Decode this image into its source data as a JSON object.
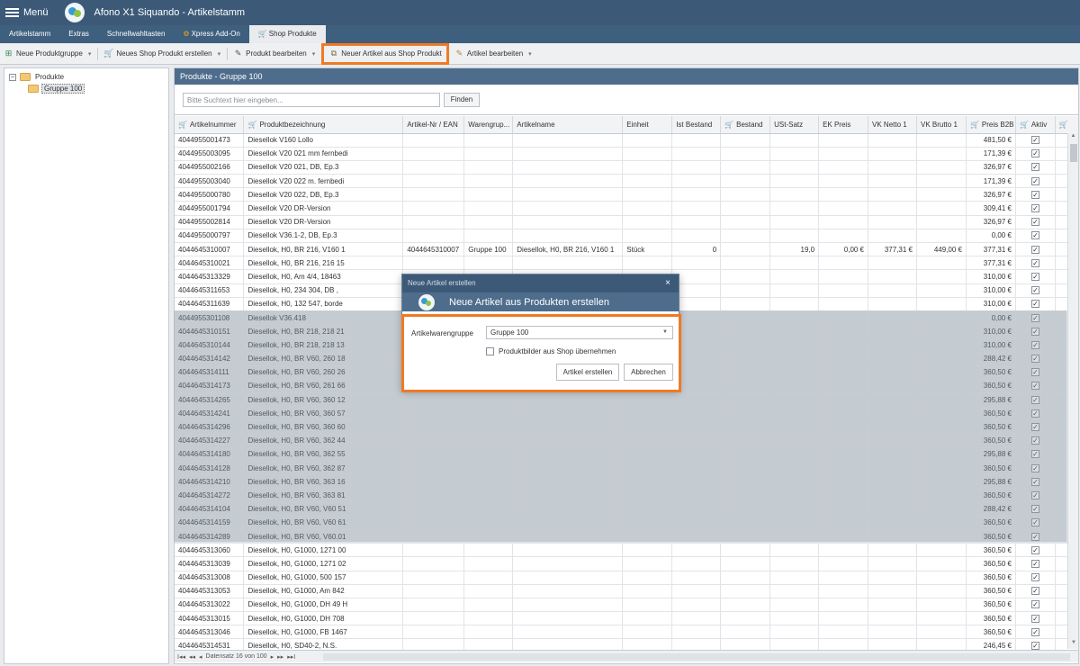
{
  "app": {
    "menu_label": "Menü",
    "title": "Afono X1 Siquando - Artikelstamm"
  },
  "tabs": [
    "Artikelstamm",
    "Extras",
    "Schnellwahltasten",
    "Xpress Add-On",
    "Shop Produkte"
  ],
  "toolbar": {
    "new_group": "Neue Produktgruppe",
    "new_shop_product": "Neues Shop Produkt erstellen",
    "edit_product": "Produkt bearbeiten",
    "new_article_from_shop": "Neuer Artikel aus Shop Produkt",
    "edit_article": "Artikel bearbeiten"
  },
  "tree": {
    "root": "Produkte",
    "child": "Gruppe 100",
    "expander": "−"
  },
  "panel": {
    "title": "Produkte - Gruppe 100",
    "search_placeholder": "Bitte Suchtext hier eingeben...",
    "find_label": "Finden"
  },
  "columns": [
    "Artikelnummer",
    "Produktbezeichnung",
    "Artikel-Nr / EAN",
    "Warengrup...",
    "Artikelname",
    "Einheit",
    "Ist Bestand",
    "Bestand",
    "USt-Satz",
    "EK Preis",
    "VK Netto 1",
    "VK Brutto 1",
    "Preis B2B",
    "Aktiv"
  ],
  "rows": [
    [
      "4044955001473",
      "Diesellok V160 Lollo",
      "",
      "",
      "",
      "",
      "",
      "",
      "",
      "",
      "",
      "",
      "481,50 €"
    ],
    [
      "4044955003095",
      "Diesellok V20 021 mm fernbedi",
      "",
      "",
      "",
      "",
      "",
      "",
      "",
      "",
      "",
      "",
      "171,39 €"
    ],
    [
      "4044955002166",
      "Diesellok V20 021, DB, Ep.3",
      "",
      "",
      "",
      "",
      "",
      "",
      "",
      "",
      "",
      "",
      "326,97 €"
    ],
    [
      "4044955003040",
      "Diesellok V20 022 m. fernbedi",
      "",
      "",
      "",
      "",
      "",
      "",
      "",
      "",
      "",
      "",
      "171,39 €"
    ],
    [
      "4044955000780",
      "Diesellok V20 022, DB, Ep.3",
      "",
      "",
      "",
      "",
      "",
      "",
      "",
      "",
      "",
      "",
      "326,97 €"
    ],
    [
      "4044955001794",
      "Diesellok V20 DR-Version",
      "",
      "",
      "",
      "",
      "",
      "",
      "",
      "",
      "",
      "",
      "309,41 €"
    ],
    [
      "4044955002814",
      "Diesellok V20 DR-Version",
      "",
      "",
      "",
      "",
      "",
      "",
      "",
      "",
      "",
      "",
      "326,97 €"
    ],
    [
      "4044955000797",
      "Diesellok V36.1-2, DB, Ep.3",
      "",
      "",
      "",
      "",
      "",
      "",
      "",
      "",
      "",
      "",
      "0,00 €"
    ],
    [
      "4044645310007",
      "Diesellok, H0, BR 216, V160 1",
      "4044645310007",
      "Gruppe 100",
      "Diesellok, H0, BR 216, V160 1",
      "Stück",
      "0",
      "",
      "19,0",
      "0,00 €",
      "377,31 €",
      "449,00 €",
      "377,31 €"
    ],
    [
      "4044645310021",
      "Diesellok, H0, BR 216, 216 15",
      "",
      "",
      "",
      "",
      "",
      "",
      "",
      "",
      "",
      "",
      "377,31 €"
    ],
    [
      "4044645313329",
      "Diesellok, H0, Am 4/4, 18463",
      "",
      "",
      "",
      "",
      "",
      "",
      "",
      "",
      "",
      "",
      "310,00 €"
    ],
    [
      "4044645311653",
      "Diesellok, H0, 234 304, DB ,",
      "",
      "",
      "",
      "",
      "",
      "",
      "",
      "",
      "",
      "",
      "310,00 €"
    ],
    [
      "4044645311639",
      "Diesellok, H0, 132 547, borde",
      "",
      "",
      "",
      "",
      "",
      "",
      "",
      "",
      "",
      "",
      "310,00 €"
    ],
    [
      "4044955301108",
      "Diesellok V36.418",
      "",
      "",
      "",
      "",
      "",
      "",
      "",
      "",
      "",
      "",
      "0,00 €"
    ],
    [
      "4044645310151",
      "Diesellok, H0, BR 218, 218 21",
      "",
      "",
      "",
      "",
      "",
      "",
      "",
      "",
      "",
      "",
      "310,00 €"
    ],
    [
      "4044645310144",
      "Diesellok, H0, BR 218, 218 13",
      "",
      "",
      "",
      "",
      "",
      "",
      "",
      "",
      "",
      "",
      "310,00 €"
    ],
    [
      "4044645314142",
      "Diesellok, H0, BR V60, 260 18",
      "",
      "",
      "",
      "",
      "",
      "",
      "",
      "",
      "",
      "",
      "288,42 €"
    ],
    [
      "4044645314111",
      "Diesellok, H0, BR V60, 260 26",
      "",
      "",
      "",
      "",
      "",
      "",
      "",
      "",
      "",
      "",
      "360,50 €"
    ],
    [
      "4044645314173",
      "Diesellok, H0, BR V60, 261 66",
      "",
      "",
      "",
      "",
      "",
      "",
      "",
      "",
      "",
      "",
      "360,50 €"
    ],
    [
      "4044645314265",
      "Diesellok, H0, BR V60, 360 12",
      "",
      "",
      "",
      "",
      "",
      "",
      "",
      "",
      "",
      "",
      "295,88 €"
    ],
    [
      "4044645314241",
      "Diesellok, H0, BR V60, 360 57",
      "",
      "",
      "",
      "",
      "",
      "",
      "",
      "",
      "",
      "",
      "360,50 €"
    ],
    [
      "4044645314296",
      "Diesellok, H0, BR V60, 360 60",
      "",
      "",
      "",
      "",
      "",
      "",
      "",
      "",
      "",
      "",
      "360,50 €"
    ],
    [
      "4044645314227",
      "Diesellok, H0, BR V60, 362 44",
      "",
      "",
      "",
      "",
      "",
      "",
      "",
      "",
      "",
      "",
      "360,50 €"
    ],
    [
      "4044645314180",
      "Diesellok, H0, BR V60, 362 55",
      "",
      "",
      "",
      "",
      "",
      "",
      "",
      "",
      "",
      "",
      "295,88 €"
    ],
    [
      "4044645314128",
      "Diesellok, H0, BR V60, 362 87",
      "",
      "",
      "",
      "",
      "",
      "",
      "",
      "",
      "",
      "",
      "360,50 €"
    ],
    [
      "4044645314210",
      "Diesellok, H0, BR V60, 363 16",
      "",
      "",
      "",
      "",
      "",
      "",
      "",
      "",
      "",
      "",
      "295,88 €"
    ],
    [
      "4044645314272",
      "Diesellok, H0, BR V60, 363 81",
      "",
      "",
      "",
      "",
      "",
      "",
      "",
      "",
      "",
      "",
      "360,50 €"
    ],
    [
      "4044645314104",
      "Diesellok, H0, BR V60, V60 51",
      "",
      "",
      "",
      "",
      "",
      "",
      "",
      "",
      "",
      "",
      "288,42 €"
    ],
    [
      "4044645314159",
      "Diesellok, H0, BR V60, V60 61",
      "",
      "",
      "",
      "",
      "",
      "",
      "",
      "",
      "",
      "",
      "360,50 €"
    ],
    [
      "4044645314289",
      "Diesellok, H0, BR V60, V60.01",
      "",
      "",
      "",
      "",
      "",
      "",
      "",
      "",
      "",
      "",
      "360,50 €"
    ],
    [
      "4044645313060",
      "Diesellok, H0, G1000, 1271 00",
      "",
      "",
      "",
      "",
      "",
      "",
      "",
      "",
      "",
      "",
      "360,50 €"
    ],
    [
      "4044645313039",
      "Diesellok, H0, G1000, 1271 02",
      "",
      "",
      "",
      "",
      "",
      "",
      "",
      "",
      "",
      "",
      "360,50 €"
    ],
    [
      "4044645313008",
      "Diesellok, H0, G1000, 500 157",
      "",
      "",
      "",
      "",
      "",
      "",
      "",
      "",
      "",
      "",
      "360,50 €"
    ],
    [
      "4044645313053",
      "Diesellok, H0, G1000, Am 842",
      "",
      "",
      "",
      "",
      "",
      "",
      "",
      "",
      "",
      "",
      "360,50 €"
    ],
    [
      "4044645313022",
      "Diesellok, H0, G1000, DH 49 H",
      "",
      "",
      "",
      "",
      "",
      "",
      "",
      "",
      "",
      "",
      "360,50 €"
    ],
    [
      "4044645313015",
      "Diesellok, H0, G1000, DH 708",
      "",
      "",
      "",
      "",
      "",
      "",
      "",
      "",
      "",
      "",
      "360,50 €"
    ],
    [
      "4044645313046",
      "Diesellok, H0, G1000, FB 1467",
      "",
      "",
      "",
      "",
      "",
      "",
      "",
      "",
      "",
      "",
      "360,50 €"
    ],
    [
      "4044645314531",
      "Diesellok, H0, SD40-2, N.S.",
      "",
      "",
      "",
      "",
      "",
      "",
      "",
      "",
      "",
      "",
      "246,45 €"
    ]
  ],
  "check_mark": "✓",
  "navbar": {
    "first": "I◂◂",
    "prev_page": "◂◂",
    "prev": "◂",
    "record_text": "Datensatz 16 von 100",
    "next": "▸",
    "next_page": "▸▸",
    "last": "▸▸I"
  },
  "dialog": {
    "window_title": "Neue Artikel erstellen",
    "close": "×",
    "subtitle": "Neue Artikel aus Produkten erstellen",
    "group_label": "Artikelwarengruppe",
    "group_value": "Gruppe 100",
    "checkbox_label": "Produktbilder aus Shop übernehmen",
    "create_label": "Artikel erstellen",
    "cancel_label": "Abbrechen"
  }
}
